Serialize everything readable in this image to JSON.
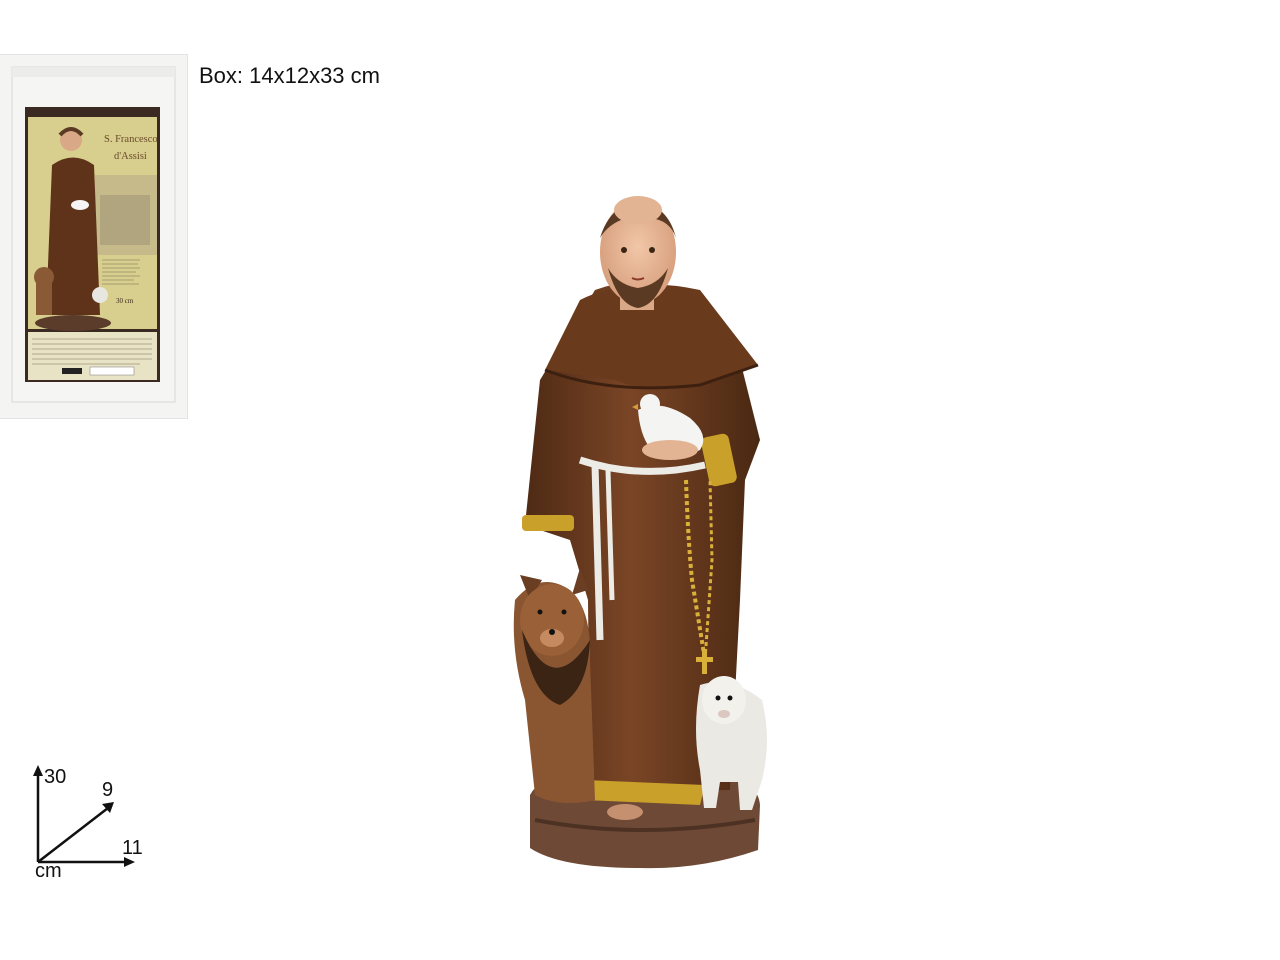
{
  "box": {
    "title_line1": "S. Francesco",
    "title_line2": "d'Assisi",
    "size_label": "30 cm",
    "dimensions_text": "Box: 14x12x33 cm"
  },
  "dimension_diagram": {
    "height": "30",
    "depth": "9",
    "width": "11",
    "unit": "cm"
  },
  "colors": {
    "robe": "#6b3a1f",
    "gold_trim": "#c9a02a",
    "base": "#6e4a36",
    "skin": "#e7b596",
    "box_panel": "#cbbf7a"
  }
}
